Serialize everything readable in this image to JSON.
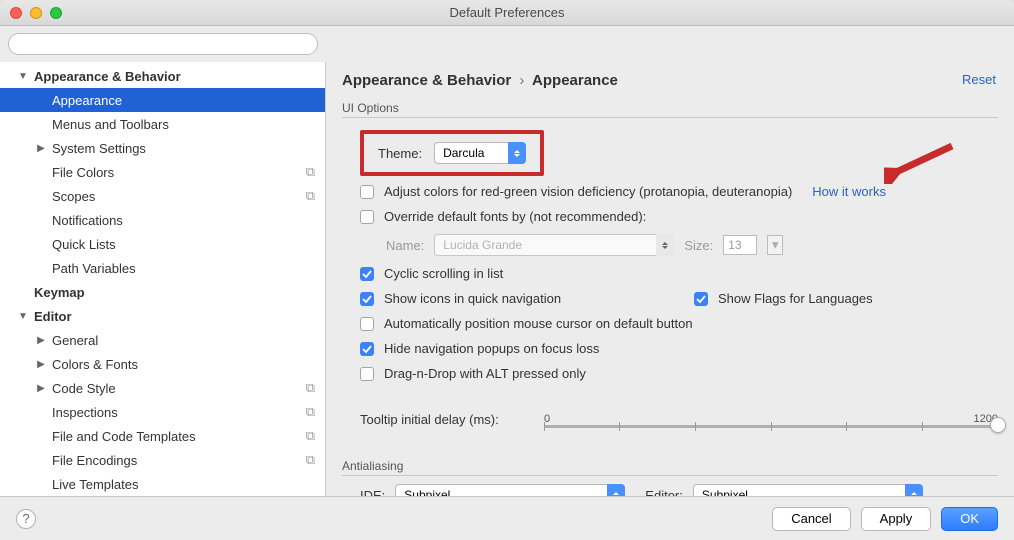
{
  "window": {
    "title": "Default Preferences"
  },
  "search": {
    "placeholder": ""
  },
  "sidebar": {
    "items": [
      {
        "label": "Appearance & Behavior",
        "depth": 0,
        "bold": true,
        "arrow": "▼"
      },
      {
        "label": "Appearance",
        "depth": 1,
        "selected": true
      },
      {
        "label": "Menus and Toolbars",
        "depth": 1
      },
      {
        "label": "System Settings",
        "depth": 1,
        "arrow": "▶"
      },
      {
        "label": "File Colors",
        "depth": 1,
        "badge": "⧉"
      },
      {
        "label": "Scopes",
        "depth": 1,
        "badge": "⧉"
      },
      {
        "label": "Notifications",
        "depth": 1
      },
      {
        "label": "Quick Lists",
        "depth": 1
      },
      {
        "label": "Path Variables",
        "depth": 1
      },
      {
        "label": "Keymap",
        "depth": 0,
        "bold": true
      },
      {
        "label": "Editor",
        "depth": 0,
        "bold": true,
        "arrow": "▼"
      },
      {
        "label": "General",
        "depth": 1,
        "arrow": "▶"
      },
      {
        "label": "Colors & Fonts",
        "depth": 1,
        "arrow": "▶"
      },
      {
        "label": "Code Style",
        "depth": 1,
        "arrow": "▶",
        "badge": "⧉"
      },
      {
        "label": "Inspections",
        "depth": 1,
        "badge": "⧉"
      },
      {
        "label": "File and Code Templates",
        "depth": 1,
        "badge": "⧉"
      },
      {
        "label": "File Encodings",
        "depth": 1,
        "badge": "⧉"
      },
      {
        "label": "Live Templates",
        "depth": 1
      }
    ]
  },
  "content": {
    "breadcrumb": {
      "parent": "Appearance & Behavior",
      "page": "Appearance"
    },
    "reset": "Reset",
    "section_ui": "UI Options",
    "theme_label": "Theme:",
    "theme_value": "Darcula",
    "adjust_colors": "Adjust colors for red-green vision deficiency (protanopia, deuteranopia)",
    "how_it_works": "How it works",
    "override_fonts": "Override default fonts by (not recommended):",
    "font_name_label": "Name:",
    "font_name_value": "Lucida Grande",
    "font_size_label": "Size:",
    "font_size_value": "13",
    "cyclic": "Cyclic scrolling in list",
    "show_icons": "Show icons in quick navigation",
    "show_flags": "Show Flags for Languages",
    "auto_cursor": "Automatically position mouse cursor on default button",
    "hide_popups": "Hide navigation popups on focus loss",
    "dnd_alt": "Drag-n-Drop with ALT pressed only",
    "tooltip_label": "Tooltip initial delay (ms):",
    "slider_min": "0",
    "slider_max": "1200",
    "section_aa": "Antialiasing",
    "aa_ide_label": "IDE:",
    "aa_ide_value": "Subpixel",
    "aa_editor_label": "Editor:",
    "aa_editor_value": "Subpixel"
  },
  "buttons": {
    "help": "?",
    "cancel": "Cancel",
    "apply": "Apply",
    "ok": "OK"
  }
}
